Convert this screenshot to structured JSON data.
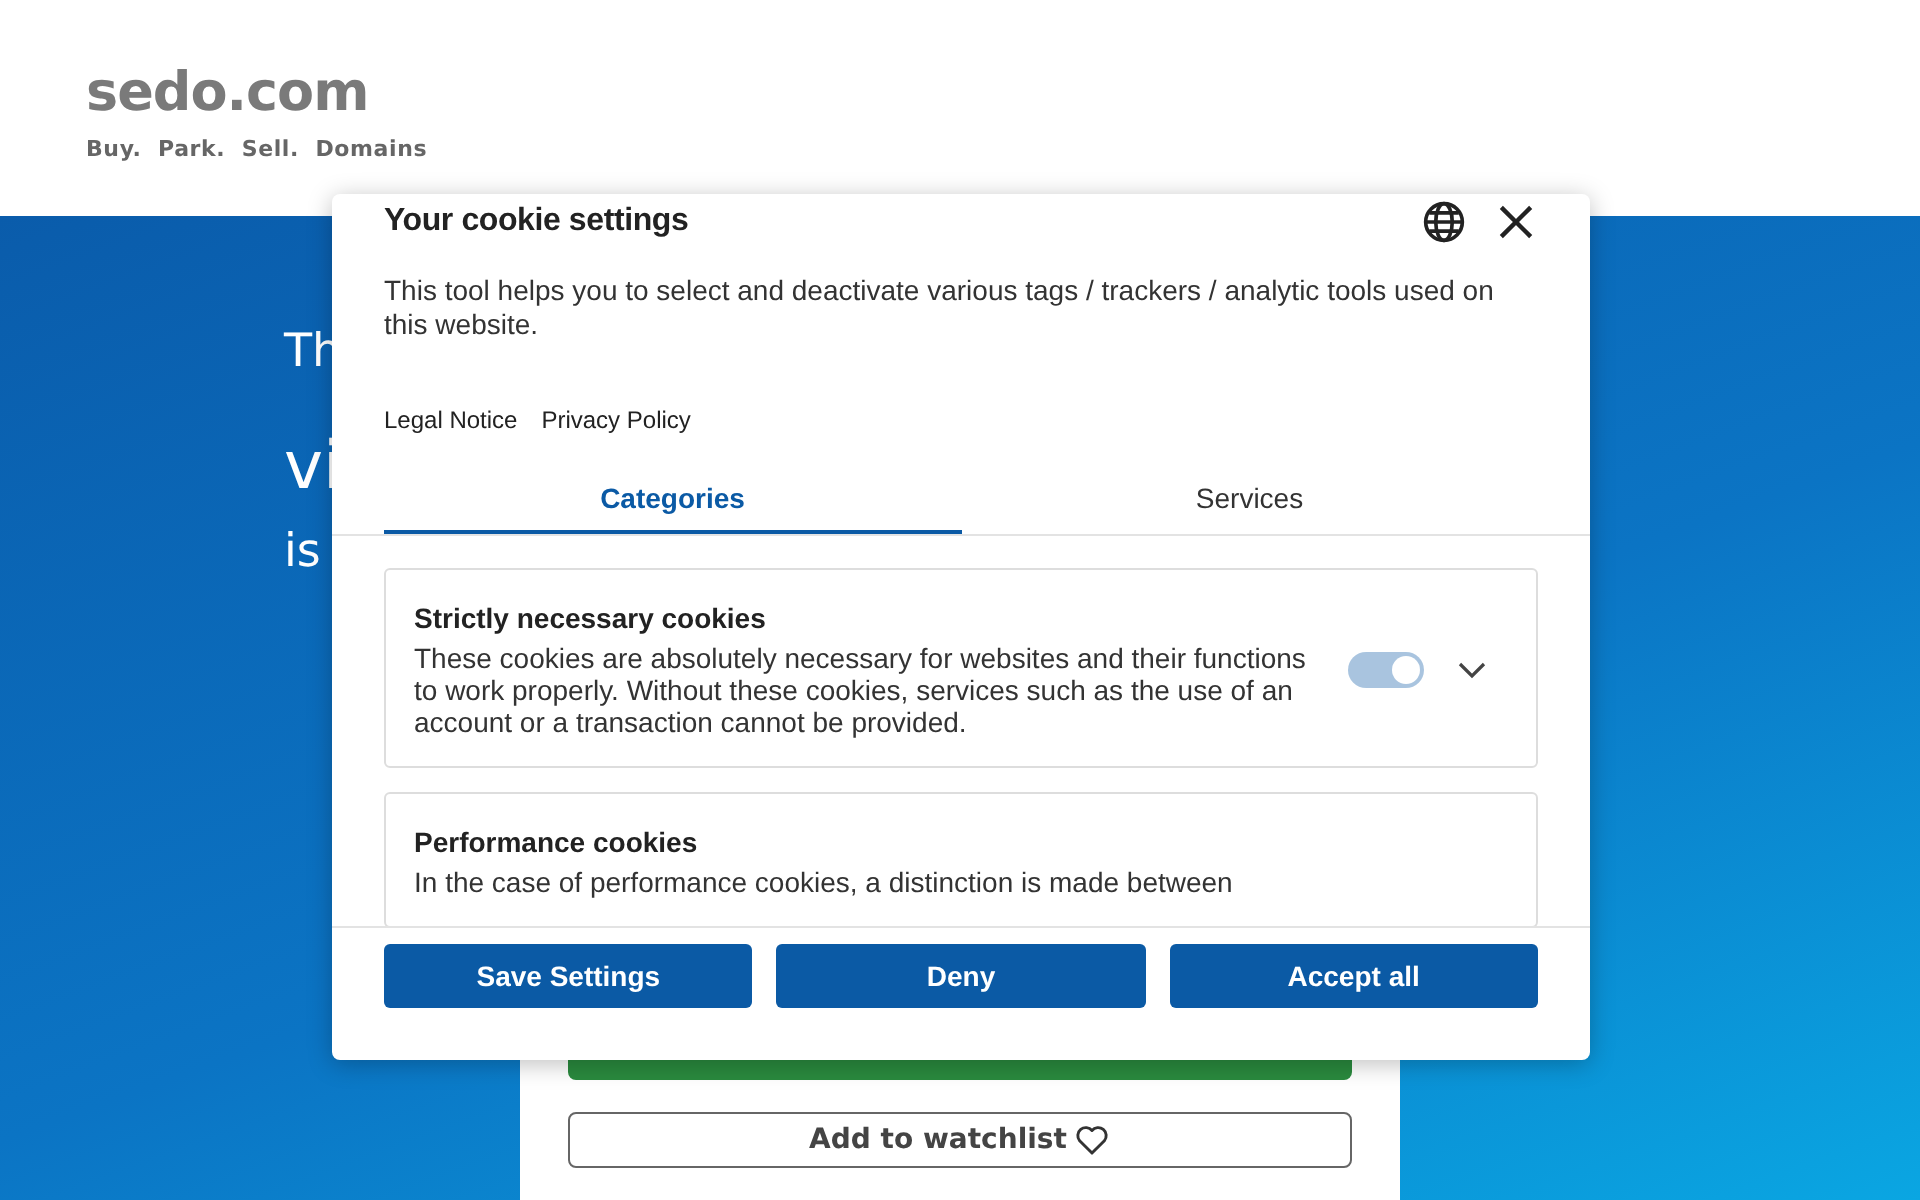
{
  "site": {
    "logo": "sedo.com",
    "tagline": "Buy.  Park.  Sell.  **Domains**",
    "hero_lines": [
      "Th",
      "vi",
      "is"
    ],
    "watchlist_button": "Add to watchlist"
  },
  "dialog": {
    "title": "Your cookie settings",
    "description": "This tool helps you to select and deactivate various tags / trackers / analytic tools used on this website.",
    "links": [
      "Legal Notice",
      "Privacy Policy"
    ],
    "tabs": [
      {
        "label": "Categories",
        "selected": true
      },
      {
        "label": "Services",
        "selected": false
      }
    ],
    "categories": [
      {
        "title": "Strictly necessary cookies",
        "description": "These cookies are absolutely necessary for websites and their functions to work properly. Without these cookies, services such as the use of an account or a transaction cannot be provided.",
        "checked": true,
        "disabled": true,
        "expanded": false
      },
      {
        "title": "Performance cookies",
        "description": "In the case of performance cookies, a distinction is made between"
      }
    ],
    "buttons": [
      "Save Settings",
      "Deny",
      "Accept all"
    ]
  }
}
